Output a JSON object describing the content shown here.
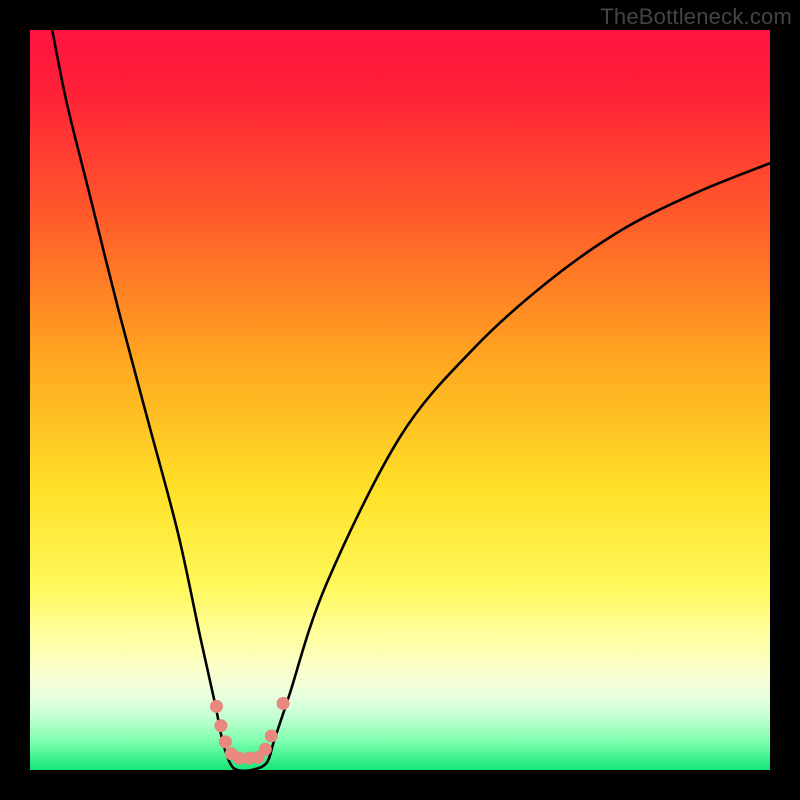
{
  "attribution": "TheBottleneck.com",
  "chart_data": {
    "type": "line",
    "title": "",
    "xlabel": "",
    "ylabel": "",
    "xlim": [
      0,
      100
    ],
    "ylim": [
      0,
      100
    ],
    "series": [
      {
        "name": "bottleneck-curve",
        "x": [
          3,
          5,
          8,
          12,
          16,
          20,
          23,
          25,
          26,
          27,
          28,
          30,
          32,
          33,
          35,
          40,
          50,
          60,
          70,
          80,
          90,
          100
        ],
        "values": [
          100,
          90,
          78,
          62,
          47,
          32,
          18,
          9,
          4,
          1,
          0,
          0,
          1,
          4,
          10,
          25,
          45,
          57,
          66,
          73,
          78,
          82
        ]
      }
    ],
    "gradient_stops": [
      {
        "offset": 0,
        "color": "#ff1440"
      },
      {
        "offset": 0.08,
        "color": "#ff2038"
      },
      {
        "offset": 0.25,
        "color": "#ff5a2a"
      },
      {
        "offset": 0.45,
        "color": "#ffa820"
      },
      {
        "offset": 0.62,
        "color": "#ffe028"
      },
      {
        "offset": 0.75,
        "color": "#fff85a"
      },
      {
        "offset": 0.82,
        "color": "#ffffa0"
      },
      {
        "offset": 0.87,
        "color": "#faffd0"
      },
      {
        "offset": 0.9,
        "color": "#e8ffe0"
      },
      {
        "offset": 0.93,
        "color": "#c0ffd0"
      },
      {
        "offset": 0.96,
        "color": "#80ffb0"
      },
      {
        "offset": 1.0,
        "color": "#14e878"
      }
    ],
    "markers": [
      {
        "x": 25.2,
        "y": 8.6,
        "r": 6.5,
        "color": "#e8887f"
      },
      {
        "x": 25.8,
        "y": 6.0,
        "r": 6.5,
        "color": "#e8887f"
      },
      {
        "x": 26.4,
        "y": 3.8,
        "r": 6.5,
        "color": "#e8887f"
      },
      {
        "x": 27.2,
        "y": 2.2,
        "r": 6.5,
        "color": "#e8887f"
      },
      {
        "x": 28.3,
        "y": 1.6,
        "r": 6.5,
        "color": "#e8887f"
      },
      {
        "x": 29.6,
        "y": 1.6,
        "r": 6.5,
        "color": "#e8887f"
      },
      {
        "x": 30.8,
        "y": 1.7,
        "r": 6.5,
        "color": "#e8887f"
      },
      {
        "x": 31.8,
        "y": 2.8,
        "r": 6.5,
        "color": "#e8887f"
      },
      {
        "x": 32.6,
        "y": 4.6,
        "r": 6.5,
        "color": "#e8887f"
      },
      {
        "x": 34.2,
        "y": 9.0,
        "r": 6.5,
        "color": "#e8887f"
      }
    ]
  }
}
